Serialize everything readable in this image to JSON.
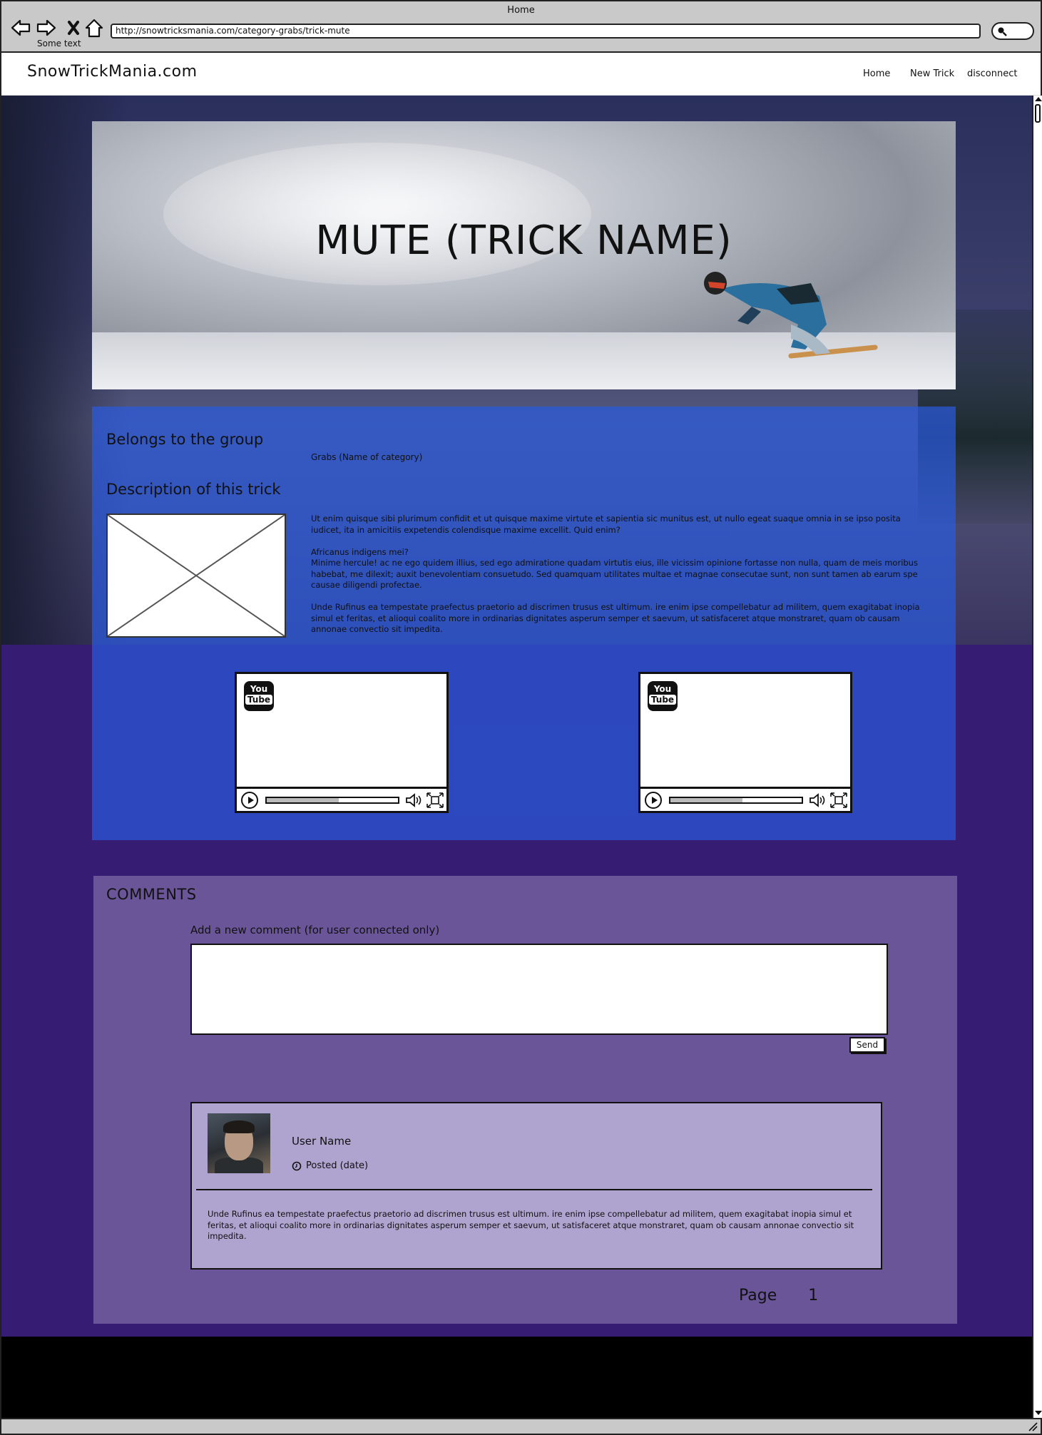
{
  "browser": {
    "window_title": "Home",
    "url": "http://snowtricksmania.com/category-grabs/trick-mute",
    "sub_label": "Some text",
    "back_icon": "arrow-left-icon",
    "forward_icon": "arrow-right-icon",
    "stop_icon": "close-icon",
    "home_icon": "home-icon",
    "search_icon": "search-icon"
  },
  "header": {
    "logo": "SnowTrickMania.com",
    "nav": [
      "Home",
      "New Trick",
      "disconnect"
    ]
  },
  "hero": {
    "title": "MUTE (TRICK NAME)"
  },
  "info": {
    "group_heading": "Belongs to the group",
    "category": "Grabs (Name of category)",
    "description_heading": "Description of this trick",
    "paragraphs": [
      "Ut enim quisque sibi plurimum confidit et ut quisque maxime virtute et sapientia sic munitus est, ut nullo egeat suaque omnia in se ipso posita iudicet, ita in amicitiis expetendis colendisque maxime excellit. Quid enim?",
      "Africanus indigens mei?\nMinime hercule! ac ne ego quidem illius, sed ego admiratione quadam virtutis eius, ille vicissim opinione fortasse non nulla, quam de meis moribus habebat, me dilexit; auxit benevolentiam consuetudo. Sed quamquam utilitates multae et magnae consecutae sunt, non sunt tamen ab earum spe causae diligendi profectae.",
      "Unde Rufinus ea tempestate praefectus praetorio ad discrimen trusus est ultimum. ire enim ipse compellebatur ad militem, quem exagitabat inopia simul et feritas, et alioqui coalito more in ordinarias dignitates asperum semper et saevum, ut satisfaceret atque monstraret, quam ob causam annonae convectio sit impedita."
    ],
    "videos": [
      {
        "logo_you": "You",
        "logo_tube": "Tube",
        "progress": 0.55
      },
      {
        "logo_you": "You",
        "logo_tube": "Tube",
        "progress": 0.55
      }
    ]
  },
  "comments": {
    "title": "COMMENTS",
    "add_label": "Add a new comment (for user connected only)",
    "input_value": "",
    "send_label": "Send",
    "items": [
      {
        "user": "User Name",
        "posted": "Posted (date)",
        "body": "Unde Rufinus ea tempestate praefectus praetorio ad discrimen trusus est ultimum. ire enim ipse compellebatur ad militem, quem exagitabat inopia simul et feritas, et alioqui coalito more in ordinarias dignitates asperum semper et saevum, ut satisfaceret atque monstraret, quam ob causam annonae convectio sit impedita."
      }
    ],
    "pager_label": "Page",
    "pager_number": "1"
  },
  "colors": {
    "page_bg": "#361c73",
    "info_bg": "#2a5adc",
    "comments_bg": "#6a5599",
    "comment_card_bg": "#aea4cf",
    "footer_bg": "#000000"
  }
}
